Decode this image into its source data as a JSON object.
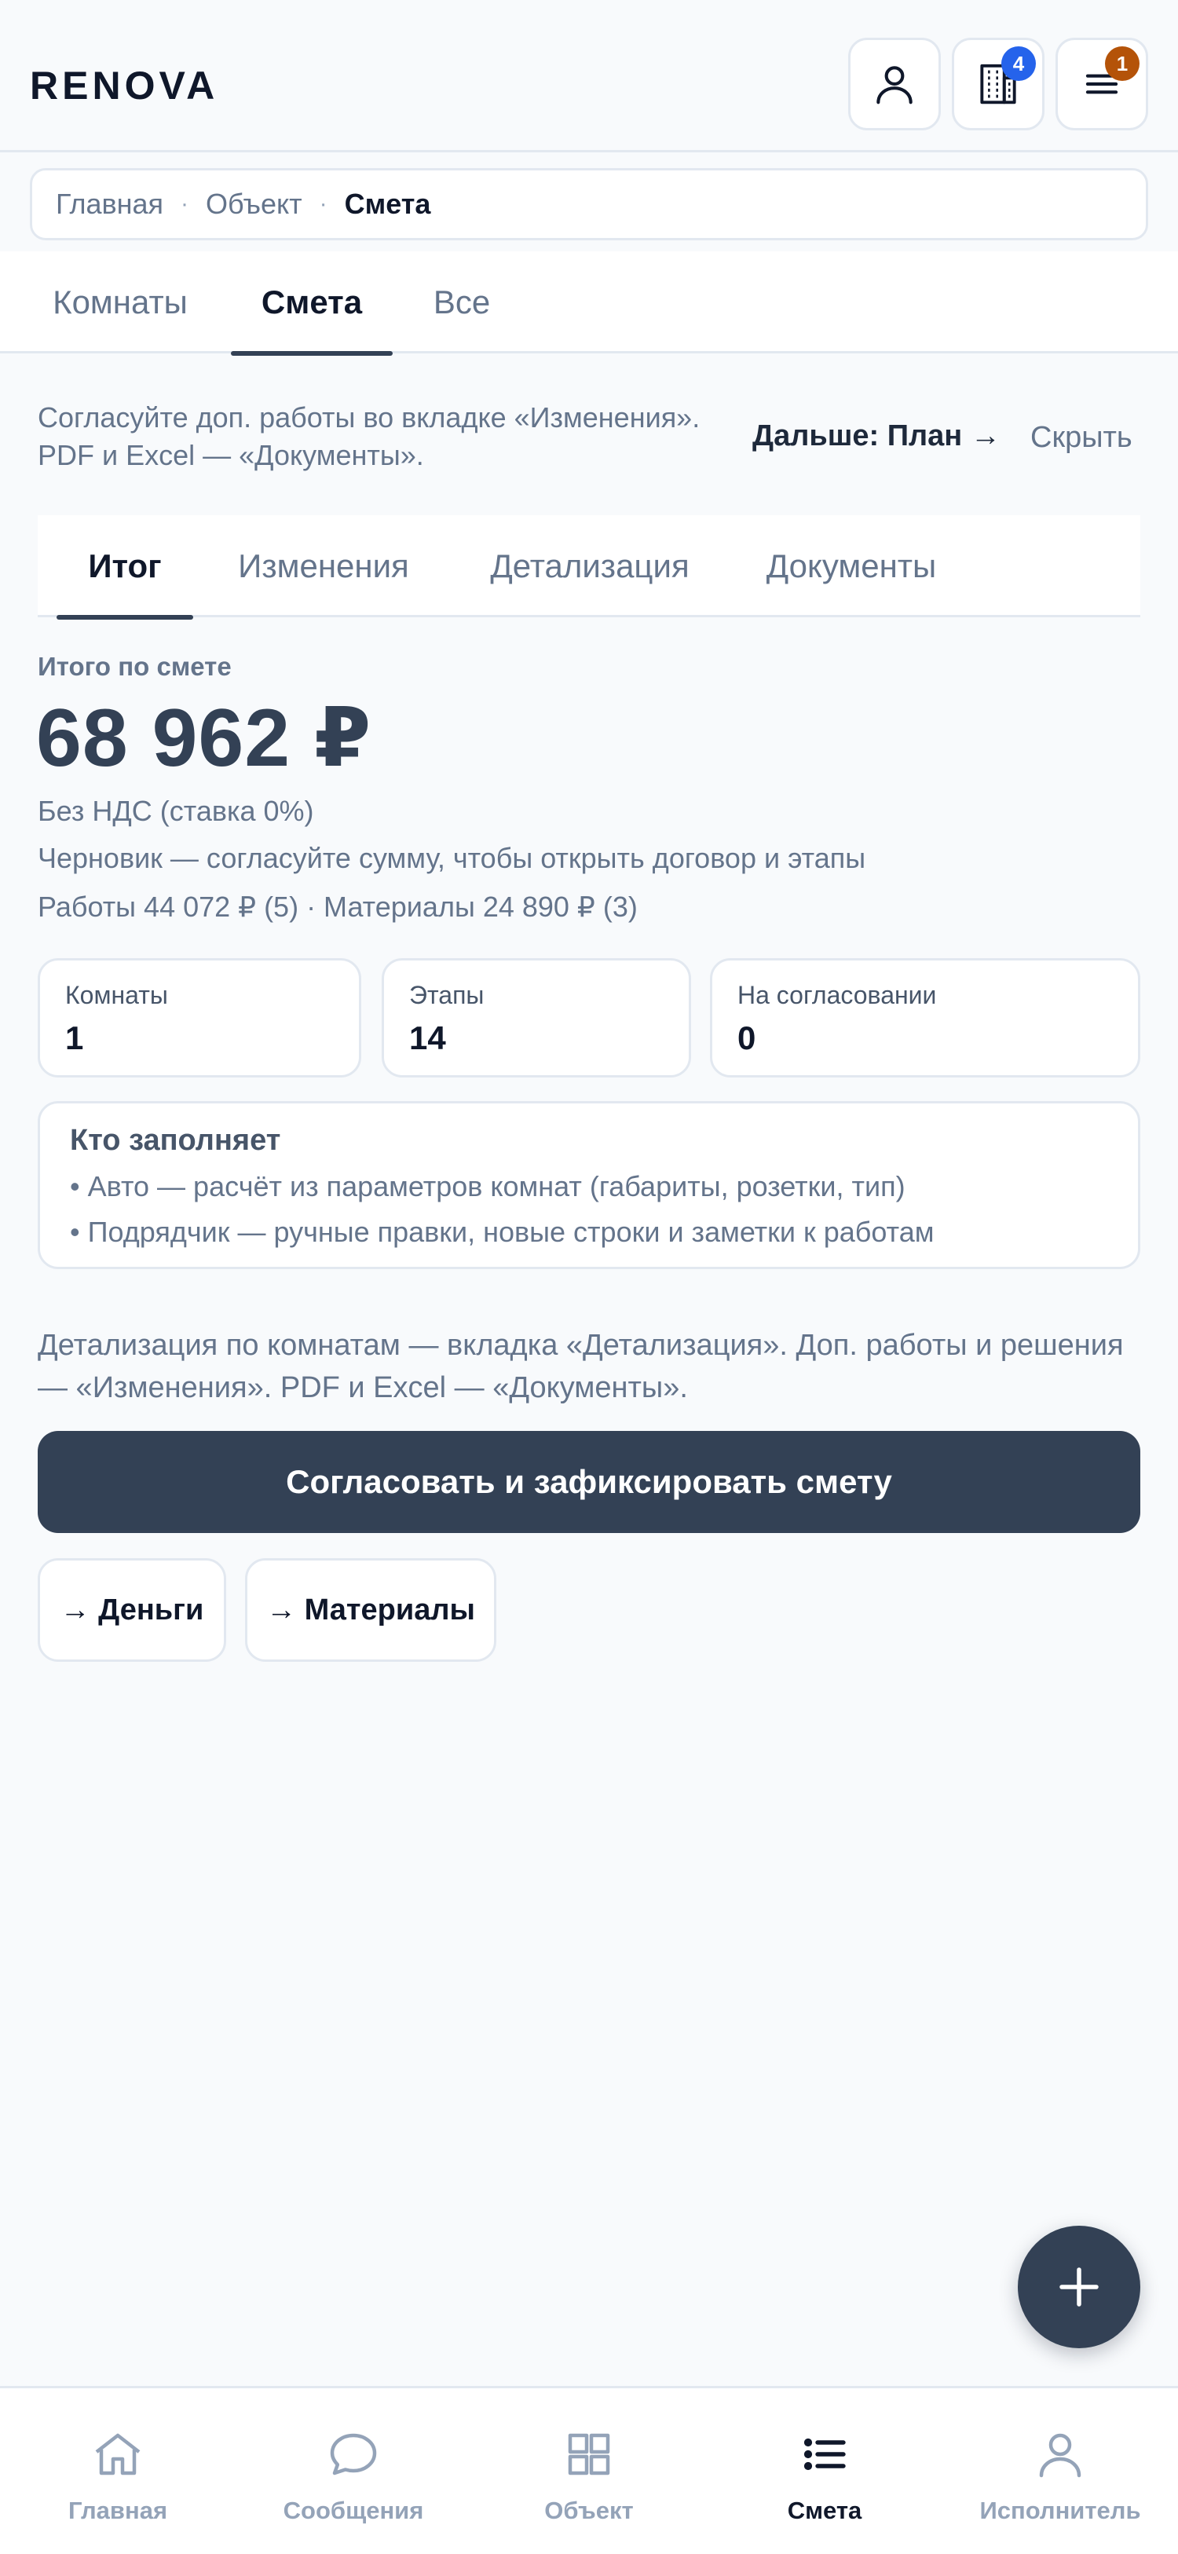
{
  "app": {
    "logo": "RENOVA"
  },
  "header": {
    "buildings_badge": "4",
    "menu_badge": "1",
    "colors": {
      "buildings_badge": "#2563eb",
      "menu_badge": "#b45309"
    }
  },
  "breadcrumb": {
    "items": [
      "Главная",
      "Объект",
      "Смета"
    ],
    "separator": "·"
  },
  "main_tabs": [
    "Комнаты",
    "Смета",
    "Все"
  ],
  "hint": {
    "text": "Согласуйте доп. работы во вкладке «Изменения». PDF и Excel — «Документы».",
    "next_label": "Дальше: План →",
    "hide_label": "Скрыть"
  },
  "sub_tabs": [
    "Итог",
    "Изменения",
    "Детализация",
    "Документы"
  ],
  "summary": {
    "label": "Итого по смете",
    "amount": "68 962 ₽",
    "vat": "Без НДС (ставка 0%)",
    "status": "Черновик — согласуйте сумму, чтобы открыть договор и этапы",
    "breakdown": "Работы 44 072 ₽ (5) · Материалы 24 890 ₽ (3)"
  },
  "stats": [
    {
      "label": "Комнаты",
      "value": "1"
    },
    {
      "label": "Этапы",
      "value": "14"
    },
    {
      "label": "На согласовании",
      "value": "0"
    }
  ],
  "who_fills": {
    "title": "Кто заполняет",
    "lines": [
      "• Авто — расчёт из параметров комнат (габариты, розетки, тип)",
      "• Подрядчик — ручные правки, новые строки и заметки к работам"
    ]
  },
  "detail_text": "Детализация по комнатам — вкладка «Детализация». Доп. работы и решения — «Изменения». PDF и Excel — «Документы».",
  "actions": {
    "primary": "Согласовать и зафиксировать смету",
    "money": "→ Деньги",
    "materials": "→ Материалы"
  },
  "bottom_nav": [
    {
      "label": "Главная",
      "icon": "home-icon"
    },
    {
      "label": "Сообщения",
      "icon": "chat-icon"
    },
    {
      "label": "Объект",
      "icon": "grid-icon"
    },
    {
      "label": "Смета",
      "icon": "list-icon"
    },
    {
      "label": "Исполнитель",
      "icon": "person-icon"
    }
  ],
  "active_nav": "Смета"
}
